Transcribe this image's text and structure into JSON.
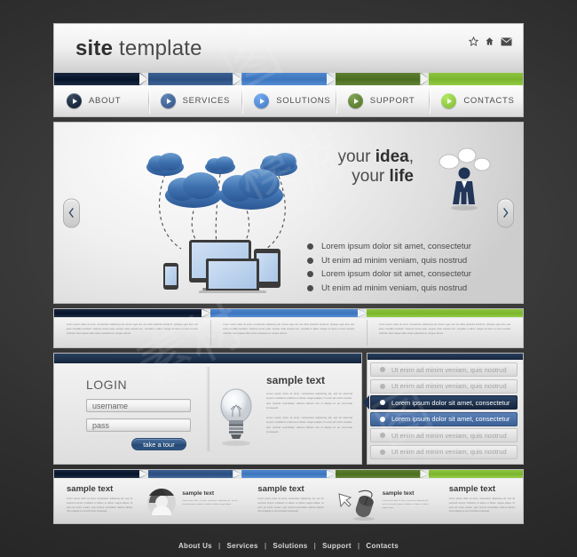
{
  "site": {
    "logo_bold": "site",
    "logo_light": " template"
  },
  "header_icons": [
    {
      "name": "star-icon",
      "label": "Favorites"
    },
    {
      "name": "home-icon",
      "label": "Home"
    },
    {
      "name": "mail-icon",
      "label": "Mail"
    }
  ],
  "nav": {
    "items": [
      {
        "label": "ABOUT",
        "color": "#17263d"
      },
      {
        "label": "SERVICES",
        "color": "#3c6091"
      },
      {
        "label": "SOLUTIONS",
        "color": "#4f87cf"
      },
      {
        "label": "SUPPORT",
        "color": "#5d7f32"
      },
      {
        "label": "CONTACTS",
        "color": "#8dc63f"
      }
    ]
  },
  "arrow_colors": [
    "#17263d",
    "#3c6091",
    "#4f87cf",
    "#5d7f32",
    "#8dc63f"
  ],
  "hero": {
    "prev_label": "Previous slide",
    "next_label": "Next slide",
    "title_line1_light": "your ",
    "title_line1_bold": "idea",
    "title_line1_tail": ",",
    "title_line2_light": "your ",
    "title_line2_bold": "life",
    "bullets": [
      "Lorem ipsum dolor sit amet, consectetur",
      "Ut enim ad minim veniam, quis nostrud",
      "Lorem ipsum dolor sit amet, consectetur",
      "Ut enim ad minim veniam, quis nostrud"
    ]
  },
  "triband": {
    "colors": [
      "#17263d",
      "#4f87cf",
      "#8dc63f"
    ],
    "columns": [
      {
        "text": "Lorem ipsum dolor sit amet, consectetur adipiscing elit. Donec eget nisi nec dolor pharetra hendrerit. Quisque eget arcu sed justo convallis hendrerit. Vivamus lectus justo, semper vitae suscipit non, convallis in tellus. Integer sit lacus ut risus suscipit vehicula. Sed massa nulla, luctus a placerat ut, congue nisl leo."
      },
      {
        "text": "Lorem ipsum dolor sit amet, consectetur adipiscing elit. Donec eget nisi nec dolor pharetra hendrerit. Quisque eget arcu sed justo convallis hendrerit. Vivamus lectus justo, semper vitae suscipit non, convallis in tellus. Integer sit lacus ut risus suscipit vehicula. Sed massa nulla, luctus a placerat ut, congue nisl leo."
      },
      {
        "text": "Lorem ipsum dolor sit amet, consectetur adipiscing elit. Donec eget nisi nec dolor pharetra hendrerit. Quisque eget arcu sed justo convallis hendrerit. Vivamus lectus justo, semper vitae suscipit non, convallis in tellus. Integer sit lacus ut risus suscipit vehicula. Sed massa nulla, luctus a placerat ut, congue nisl leo."
      }
    ]
  },
  "login": {
    "title": "LOGIN",
    "username_value": "username",
    "username_placeholder": "username",
    "password_value": "pass",
    "password_placeholder": "pass",
    "button_label": "take a tour"
  },
  "sample_panel": {
    "icon": "lightbulb-icon",
    "title": "sample text",
    "paragraph1": "Lorem ipsum dolor sit amet, consectetur adipiscing elit, sed do eiusmod tempor incididunt ut labore et dolore magna aliqua. Ut enim ad minim veniam, quis nostrud exercitation ullamco laboris nisi ut aliquip ex ea commodo consequat.",
    "paragraph2": "Lorem ipsum dolor sit amet, consectetur adipiscing elit, sed do eiusmod tempor incididunt ut labore et dolore magna aliqua. Ut enim ad minim veniam, quis nostrud exercitation ullamco laboris nisi ut aliquip ex ea commodo consequat."
  },
  "list_panel": {
    "items": [
      {
        "label": "Ut enim ad minim veniam, quis nostrud",
        "state": "plain"
      },
      {
        "label": "Ut enim ad minim veniam, quis nostrud",
        "state": "plain"
      },
      {
        "label": "Lorem ipsum dolor sit amet, consectetur",
        "state": "dark"
      },
      {
        "label": "Lorem ipsum dolor sit amet, consectetur",
        "state": "blue"
      },
      {
        "label": "Ut enim ad minim veniam, quis nostrud",
        "state": "plain"
      },
      {
        "label": "Ut enim ad minim veniam, quis nostrud",
        "state": "plain"
      }
    ]
  },
  "bottom": {
    "colors": [
      "#17263d",
      "#3c6091",
      "#4f87cf",
      "#5d7f32",
      "#8dc63f"
    ],
    "col1": {
      "title": "sample text",
      "text": "Lorem ipsum dolor sit amet, consectetur adipiscing elit, sed do eiusmod tempor incididunt ut labore et dolore magna aliqua. Ut enim ad minim veniam, quis nostrud exercitation ullamco laboris nisi ut aliquip ex ea commodo consequat."
    },
    "col2": {
      "icon": "user-avatar-icon",
      "title": "sample text",
      "text": "Lorem ipsum dolor sit amet, consectetur adipiscing elit, sed do eiusmod tempor incididunt ut labore et dolore magna aliqua."
    },
    "col3": {
      "title": "sample text",
      "text": "Lorem ipsum dolor sit amet, consectetur adipiscing elit, sed do eiusmod tempor incididunt ut labore et dolore magna aliqua. Ut enim ad minim veniam, quis nostrud exercitation ullamco laboris nisi ut aliquip ex ea commodo consequat."
    },
    "col4": {
      "icon": "mouse-cursor-icon",
      "title": "sample text",
      "text": "Lorem ipsum dolor sit amet, consectetur adipiscing elit, sed do eiusmod tempor incididunt ut labore et dolore magna aliqua."
    },
    "col5": {
      "title": "sample text",
      "text": "Lorem ipsum dolor sit amet, consectetur adipiscing elit, sed do eiusmod tempor incididunt ut labore et dolore magna aliqua. Ut enim ad minim veniam, quis nostrud exercitation ullamco laboris nisi ut aliquip ex ea commodo consequat."
    }
  },
  "footer": {
    "links": [
      "About Us",
      "Services",
      "Solutions",
      "Support",
      "Contacts"
    ],
    "separator": "|"
  }
}
